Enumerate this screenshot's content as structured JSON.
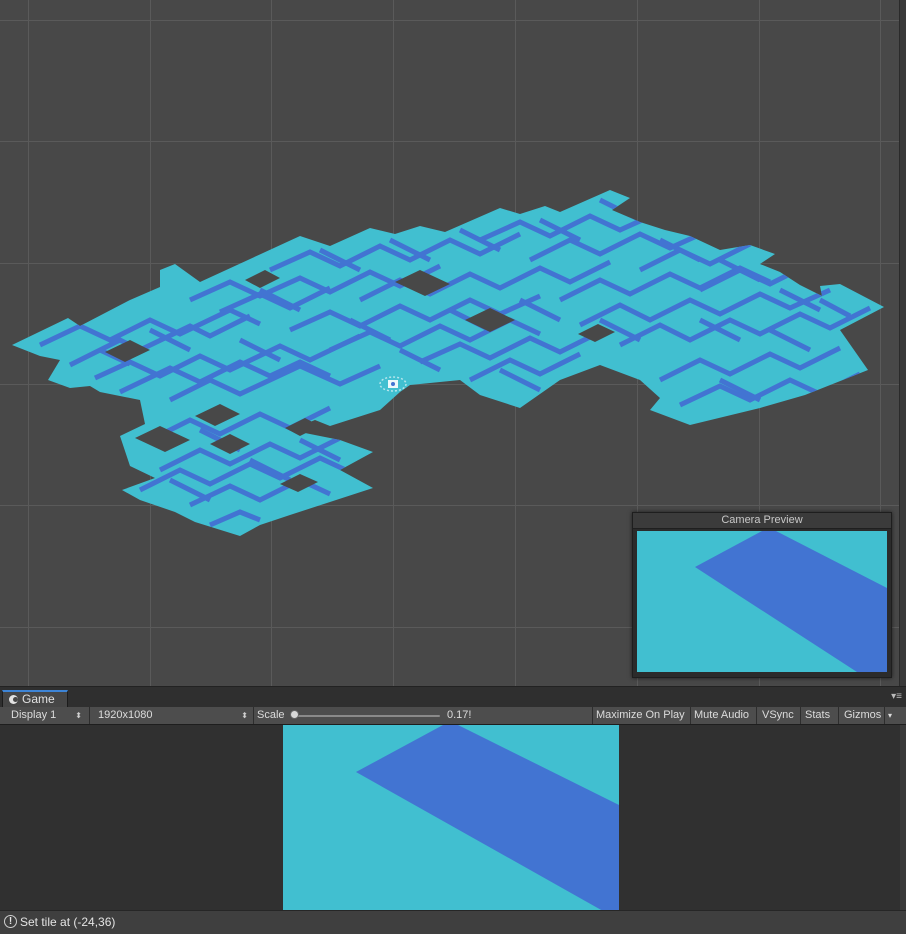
{
  "colors": {
    "tile_light": "#41bfd0",
    "tile_dark": "#4274d2",
    "scene_bg": "#484848",
    "grid_line": "#585858",
    "tab_accent": "#3d84d6"
  },
  "scene": {
    "camera_preview_title": "Camera Preview",
    "gizmo_icon": "camera-gizmo-icon"
  },
  "game": {
    "tab_label": "Game",
    "tab_icon": "game-pacman-icon",
    "panel_menu_icon": "panel-menu-icon",
    "display_select": "Display 1",
    "resolution_select": "1920x1080",
    "scale_label": "Scale",
    "scale_value": "0.17!",
    "scale_fraction": 0.0,
    "maximize_on_play": "Maximize On Play",
    "mute_audio": "Mute Audio",
    "vsync": "VSync",
    "stats": "Stats",
    "gizmos": "Gizmos"
  },
  "status_bar": {
    "icon": "info-icon",
    "message": "Set tile at (-24,36)"
  }
}
